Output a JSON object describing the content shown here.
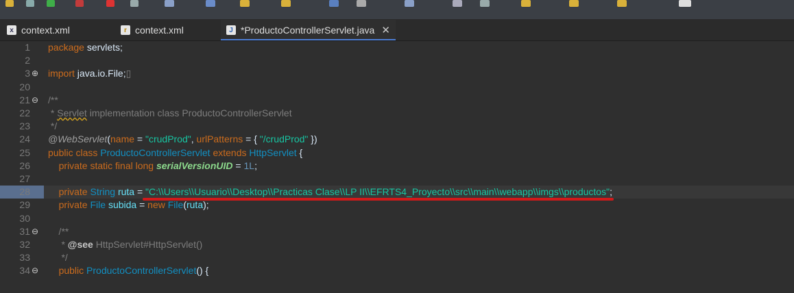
{
  "tabs": [
    {
      "icon": "xml-file-icon",
      "label": "context.xml"
    },
    {
      "icon": "context-file-icon",
      "label": "context.xml"
    },
    {
      "icon": "java-file-icon",
      "label": "*ProductoControllerServlet.java",
      "close": "✕"
    }
  ],
  "lines": [
    {
      "num": "1",
      "fold": "",
      "tokens": [
        [
          "k",
          "package"
        ],
        [
          "p",
          " servlets;"
        ]
      ]
    },
    {
      "num": "2",
      "fold": "",
      "tokens": []
    },
    {
      "num": "3",
      "fold": "⊕",
      "tokens": [
        [
          "k",
          "import"
        ],
        [
          "p",
          " java.io.File;"
        ],
        [
          "c",
          "▯"
        ]
      ]
    },
    {
      "num": "20",
      "fold": "",
      "tokens": []
    },
    {
      "num": "21",
      "fold": "⊖",
      "tokens": [
        [
          "c",
          "/**"
        ]
      ]
    },
    {
      "num": "22",
      "fold": "",
      "tokens": [
        [
          "c",
          " * "
        ],
        [
          "cs",
          "Servlet"
        ],
        [
          "c",
          " implementation class ProductoControllerServlet"
        ]
      ]
    },
    {
      "num": "23",
      "fold": "",
      "tokens": [
        [
          "c",
          " */"
        ]
      ]
    },
    {
      "num": "24",
      "fold": "",
      "tokens": [
        [
          "ann",
          "@WebServlet"
        ],
        [
          "p",
          "("
        ],
        [
          "k",
          "name"
        ],
        [
          "p",
          " = "
        ],
        [
          "s",
          "\"crudProd\""
        ],
        [
          "p",
          ", "
        ],
        [
          "k",
          "urlPatterns"
        ],
        [
          "p",
          " = { "
        ],
        [
          "s",
          "\"/crudProd\""
        ],
        [
          "p",
          " })"
        ]
      ]
    },
    {
      "num": "25",
      "fold": "",
      "tokens": [
        [
          "k",
          "public class"
        ],
        [
          "p",
          " "
        ],
        [
          "typ",
          "ProductoControllerServlet"
        ],
        [
          "p",
          " "
        ],
        [
          "k",
          "extends"
        ],
        [
          "p",
          " "
        ],
        [
          "typ",
          "HttpServlet"
        ],
        [
          "p",
          " {"
        ]
      ]
    },
    {
      "num": "26",
      "fold": "",
      "tokens": [
        [
          "p",
          "    "
        ],
        [
          "k",
          "private static final long"
        ],
        [
          "p",
          " "
        ],
        [
          "sf",
          "serialVersionUID"
        ],
        [
          "p",
          " = "
        ],
        [
          "num",
          "1L"
        ],
        [
          "p",
          ";"
        ]
      ]
    },
    {
      "num": "27",
      "fold": "",
      "tokens": []
    },
    {
      "num": "28",
      "fold": "",
      "tokens": [
        [
          "p",
          "    "
        ],
        [
          "k",
          "private"
        ],
        [
          "p",
          " "
        ],
        [
          "typ",
          "String"
        ],
        [
          "p",
          " "
        ],
        [
          "fn",
          "ruta"
        ],
        [
          "p",
          " = "
        ],
        [
          "s",
          "\"C:\\\\Users\\\\Usuario\\\\Desktop\\\\Practicas Clase\\\\LP II\\\\EFRTS4_Proyecto\\\\src\\\\main\\\\webapp\\\\imgs\\\\productos\""
        ],
        [
          "p",
          ";"
        ]
      ]
    },
    {
      "num": "29",
      "fold": "",
      "tokens": [
        [
          "p",
          "    "
        ],
        [
          "k",
          "private"
        ],
        [
          "p",
          " "
        ],
        [
          "typ",
          "File"
        ],
        [
          "p",
          " "
        ],
        [
          "fn",
          "subida"
        ],
        [
          "p",
          " = "
        ],
        [
          "k",
          "new"
        ],
        [
          "p",
          " "
        ],
        [
          "typ",
          "File"
        ],
        [
          "p",
          "("
        ],
        [
          "fn",
          "ruta"
        ],
        [
          "p",
          ");"
        ]
      ]
    },
    {
      "num": "30",
      "fold": "",
      "tokens": []
    },
    {
      "num": "31",
      "fold": "⊖",
      "tokens": [
        [
          "c",
          "    /**"
        ]
      ]
    },
    {
      "num": "32",
      "fold": "",
      "tokens": [
        [
          "c",
          "     * "
        ],
        [
          "cb",
          "@see"
        ],
        [
          "c",
          " HttpServlet#HttpServlet()"
        ]
      ]
    },
    {
      "num": "33",
      "fold": "",
      "tokens": [
        [
          "c",
          "     */"
        ]
      ]
    },
    {
      "num": "34",
      "fold": "⊖",
      "tokens": [
        [
          "p",
          "    "
        ],
        [
          "k",
          "public"
        ],
        [
          "p",
          " "
        ],
        [
          "typ",
          "ProductoControllerServlet"
        ],
        [
          "p",
          "() {"
        ]
      ]
    }
  ]
}
